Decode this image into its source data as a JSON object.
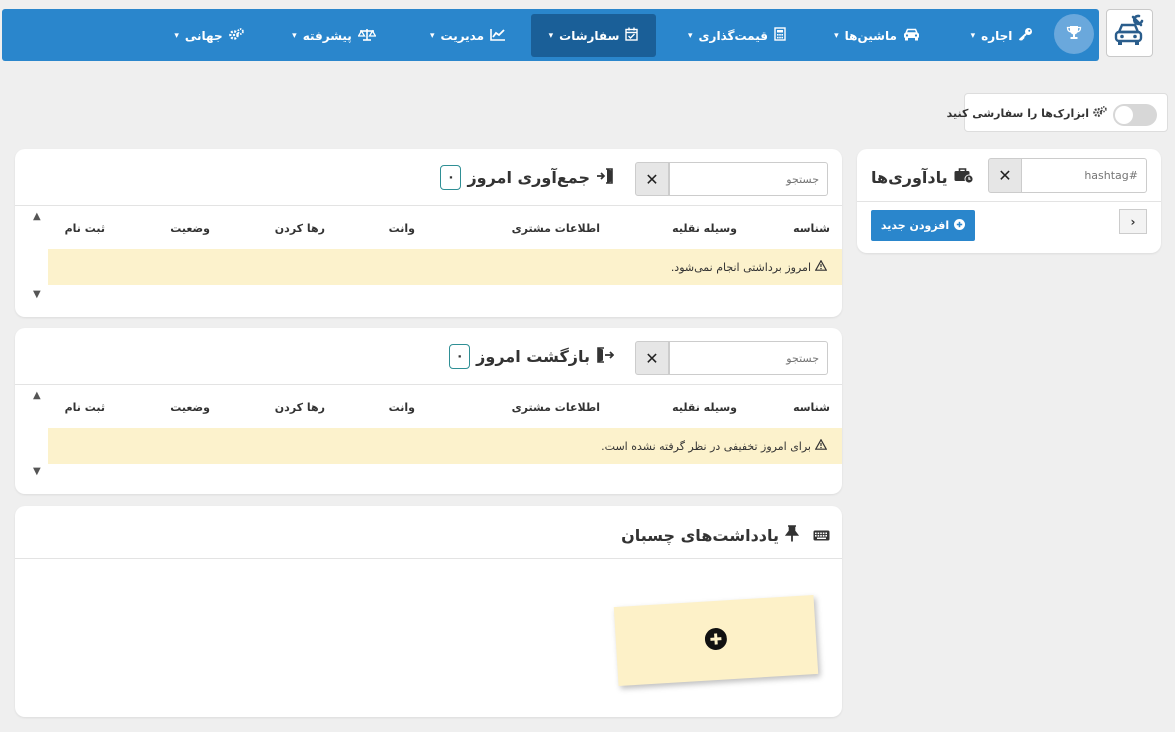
{
  "navbar": {
    "items": [
      {
        "label": "اجاره",
        "icon": "key-icon"
      },
      {
        "label": "ماشین‌ها",
        "icon": "car-icon"
      },
      {
        "label": "قیمت‌گذاری",
        "icon": "calculator-icon"
      },
      {
        "label": "سفارشات",
        "icon": "calendar-check-icon",
        "active": true
      },
      {
        "label": "مدیریت",
        "icon": "chart-icon"
      },
      {
        "label": "پیشرفته",
        "icon": "scale-icon"
      },
      {
        "label": "جهانی",
        "icon": "cogs-icon"
      }
    ],
    "trophy_icon": "trophy-icon",
    "logo_icon": "car-mechanic-logo-icon",
    "colors": {
      "bar": "#2a86cc",
      "active": "#1a5f98"
    }
  },
  "customize_widgets": {
    "label": "ابزارک‌ها را سفارشی کنید",
    "enabled": false
  },
  "pickup_today": {
    "title": "جمع‌آوری امروز",
    "count": "۰",
    "search_placeholder": "جستجو",
    "columns": [
      "شناسه",
      "وسیله نقلیه",
      "اطلاعات مشتری",
      "وانت",
      "رها کردن",
      "وضعیت",
      "ثبت نام"
    ],
    "warning": "امروز برداشتی انجام نمی‌شود."
  },
  "return_today": {
    "title": "بازگشت امروز",
    "count": "۰",
    "search_placeholder": "جستجو",
    "columns": [
      "شناسه",
      "وسیله نقلیه",
      "اطلاعات مشتری",
      "وانت",
      "رها کردن",
      "وضعیت",
      "ثبت نام"
    ],
    "warning": "برای امروز تخفیفی در نظر گرفته نشده است."
  },
  "sticky_notes": {
    "title": "یادداشت‌های چسبان",
    "note_color": "#fdf1c8"
  },
  "reminders": {
    "title": "یادآوری‌ها",
    "hashtag_placeholder": "#hashtag",
    "add_label": "افزودن جدید"
  },
  "colors": {
    "warning_bg": "#fcf2cc",
    "badge_border": "#2f8f95",
    "page_bg": "#efefef"
  }
}
